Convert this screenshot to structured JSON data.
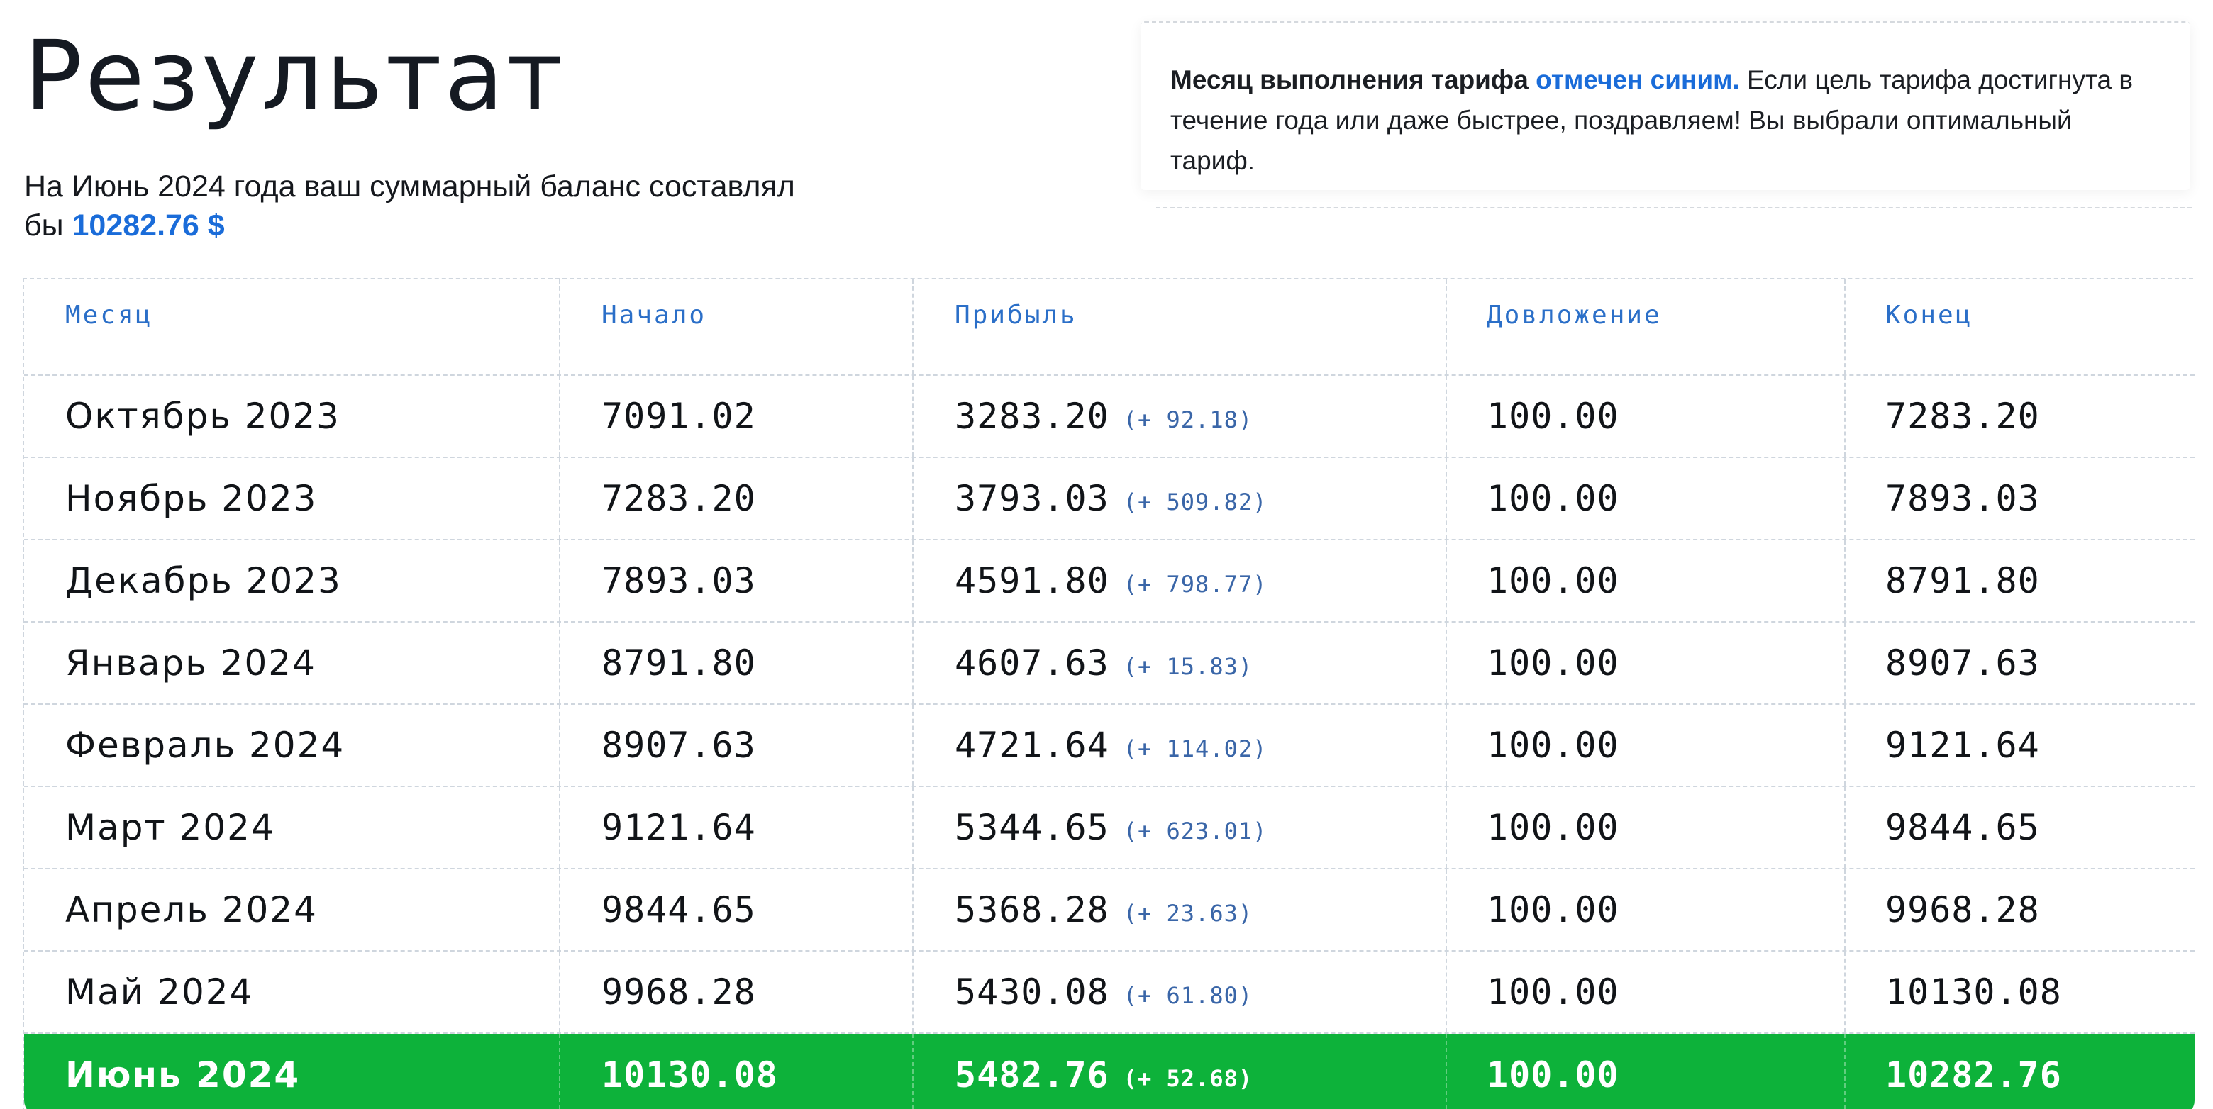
{
  "header": {
    "title": "Результат",
    "summary_text": "На Июнь 2024 года ваш суммарный баланс составлял бы",
    "summary_amount": "10282.76 $"
  },
  "note": {
    "part1": "Месяц выполнения тарифа",
    "part2_blue": "отмечен синим.",
    "part3": "Если цель тарифа достигнута в течение года или даже быстрее, поздравляем! Вы выбрали оптимальный тариф."
  },
  "table": {
    "columns": [
      "Месяц",
      "Начало",
      "Прибыль",
      "Довложение",
      "Конец"
    ],
    "rows": [
      {
        "month": "Октябрь 2023",
        "start": "7091.02",
        "profit": "3283.20",
        "delta": "(+ 92.18)",
        "deposit": "100.00",
        "end": "7283.20"
      },
      {
        "month": "Ноябрь 2023",
        "start": "7283.20",
        "profit": "3793.03",
        "delta": "(+ 509.82)",
        "deposit": "100.00",
        "end": "7893.03"
      },
      {
        "month": "Декабрь 2023",
        "start": "7893.03",
        "profit": "4591.80",
        "delta": "(+ 798.77)",
        "deposit": "100.00",
        "end": "8791.80"
      },
      {
        "month": "Январь 2024",
        "start": "8791.80",
        "profit": "4607.63",
        "delta": "(+ 15.83)",
        "deposit": "100.00",
        "end": "8907.63"
      },
      {
        "month": "Февраль 2024",
        "start": "8907.63",
        "profit": "4721.64",
        "delta": "(+ 114.02)",
        "deposit": "100.00",
        "end": "9121.64"
      },
      {
        "month": "Март 2024",
        "start": "9121.64",
        "profit": "5344.65",
        "delta": "(+ 623.01)",
        "deposit": "100.00",
        "end": "9844.65"
      },
      {
        "month": "Апрель 2024",
        "start": "9844.65",
        "profit": "5368.28",
        "delta": "(+ 23.63)",
        "deposit": "100.00",
        "end": "9968.28"
      },
      {
        "month": "Май 2024",
        "start": "9968.28",
        "profit": "5430.08",
        "delta": "(+ 61.80)",
        "deposit": "100.00",
        "end": "10130.08"
      },
      {
        "month": "Июнь 2024",
        "start": "10130.08",
        "profit": "5482.76",
        "delta": "(+ 52.68)",
        "deposit": "100.00",
        "end": "10282.76"
      }
    ],
    "highlight_color": "#0db23a"
  }
}
